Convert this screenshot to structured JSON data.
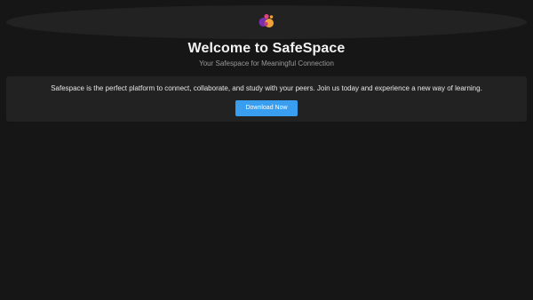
{
  "header": {
    "logo_icon": "safespace-logo-icon",
    "title": "Welcome to SafeSpace",
    "subtitle": "Your Safespace for Meaningful Connection"
  },
  "intro": {
    "description": "Safespace is the perfect platform to connect, collaborate, and study with your peers. Join us today and experience a new way of learning.",
    "download_label": "Download Now"
  },
  "colors": {
    "background": "#161616",
    "card": "#222222",
    "accent": "#3a9ef0",
    "logo_purple": "#7a2fb0",
    "logo_orange": "#f2a23a",
    "logo_pink": "#e0447c"
  }
}
